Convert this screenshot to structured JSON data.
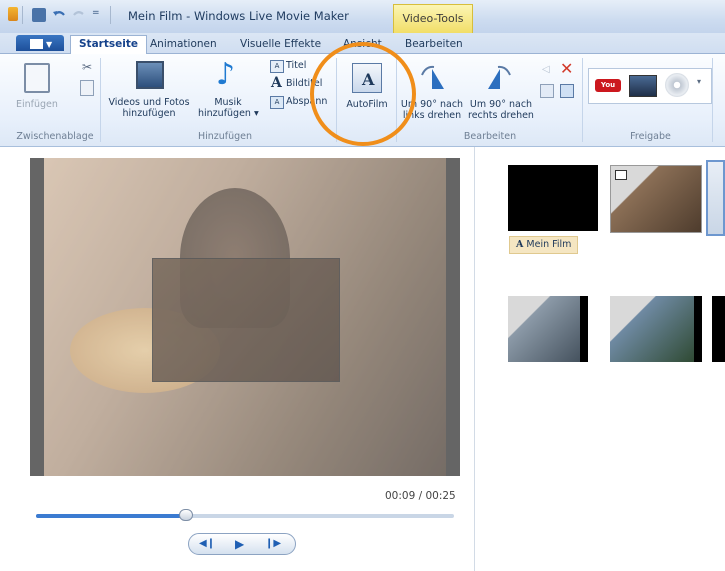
{
  "window": {
    "title": "Mein Film - Windows Live Movie Maker",
    "context_tab": "Video-Tools"
  },
  "tabs": [
    "Startseite",
    "Animationen",
    "Visuelle Effekte",
    "Ansicht",
    "Bearbeiten"
  ],
  "ribbon": {
    "paste": "Einfügen",
    "videos_photos": [
      "Videos und Fotos",
      "hinzufügen"
    ],
    "music": [
      "Musik",
      "hinzufügen ▾"
    ],
    "title": "Titel",
    "caption": "Bildtitel",
    "credits": "Abspann",
    "autofilm": "AutoFilm",
    "rotate_left": [
      "Um 90° nach",
      "links drehen"
    ],
    "rotate_right": [
      "Um 90° nach",
      "rechts drehen"
    ],
    "groups": {
      "clipboard": "Zwischenablage",
      "add": "Hinzufügen",
      "edit": "Bearbeiten",
      "share": "Freigabe"
    }
  },
  "player": {
    "time": "00:09 / 00:25",
    "progress": 0.36
  },
  "storyboard": {
    "title_clip": "Mein Film"
  },
  "colors": {
    "accent_orange": "#f08e1a",
    "ribbon_blue": "#1e395b",
    "context_yellow": "#f1dd65"
  }
}
